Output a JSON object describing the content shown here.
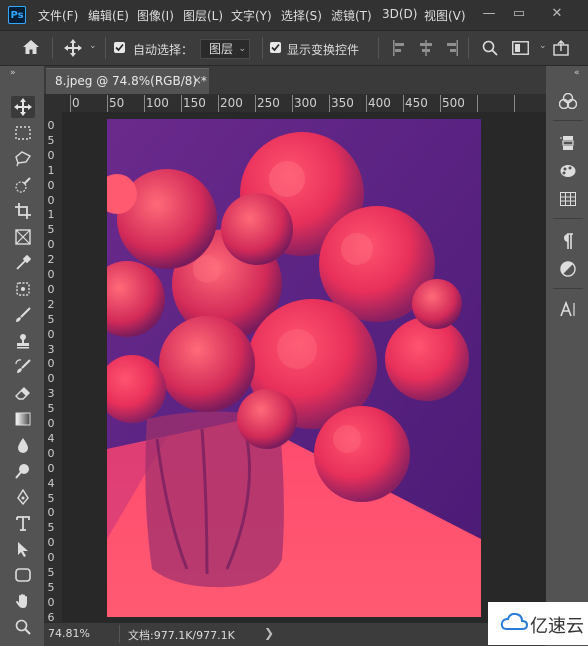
{
  "app": {
    "logo_text": "Ps"
  },
  "menu": [
    "文件(F)",
    "编辑(E)",
    "图像(I)",
    "图层(L)",
    "文字(Y)",
    "选择(S)",
    "滤镜(T)",
    "3D(D)",
    "视图(V)"
  ],
  "window_controls": {
    "minimize": "—",
    "maximize": "▭",
    "close": "✕"
  },
  "options_bar": {
    "auto_select_label": "自动选择：",
    "auto_select_checked": true,
    "auto_select_target": "图层",
    "show_transform_label": "显示变换控件",
    "show_transform_checked": true
  },
  "document": {
    "tab_title": "8.jpeg @ 74.8%(RGB/8) *",
    "tab_close": "×"
  },
  "rulers": {
    "horizontal": [
      "0",
      "50",
      "100",
      "150",
      "200",
      "250",
      "300",
      "350",
      "400",
      "450",
      "500"
    ],
    "vertical": [
      "0",
      "5",
      "0",
      "1",
      "0",
      "0",
      "1",
      "5",
      "0",
      "2",
      "0",
      "0",
      "2",
      "5",
      "0",
      "3",
      "0",
      "0",
      "3",
      "5",
      "0",
      "4",
      "0",
      "0",
      "4",
      "5",
      "0",
      "5",
      "0",
      "0",
      "5",
      "5",
      "0",
      "6"
    ]
  },
  "status": {
    "zoom": "74.81%",
    "doc_info": "文档:977.1K/977.1K",
    "arrow": "❯"
  },
  "watermark": {
    "text": "亿速云"
  },
  "colors": {
    "accent": "#31a8ff",
    "photo_base": "#5a1f7a",
    "flower_red": "#ff3f6f"
  },
  "tools": [
    "move-tool",
    "marquee-tool",
    "lasso-tool",
    "quick-select-tool",
    "crop-tool",
    "frame-tool",
    "eyedropper-tool",
    "patch-tool",
    "brush-tool",
    "stamp-tool",
    "history-brush-tool",
    "eraser-tool",
    "gradient-tool",
    "blur-tool",
    "dodge-tool",
    "pen-tool",
    "type-tool",
    "path-select-tool",
    "shape-tool",
    "hand-tool",
    "zoom-tool"
  ],
  "right_panels": [
    "color-panel",
    "history-panel",
    "adjustments-panel",
    "swatches-panel",
    "paragraph-panel",
    "properties-panel",
    "character-panel"
  ]
}
